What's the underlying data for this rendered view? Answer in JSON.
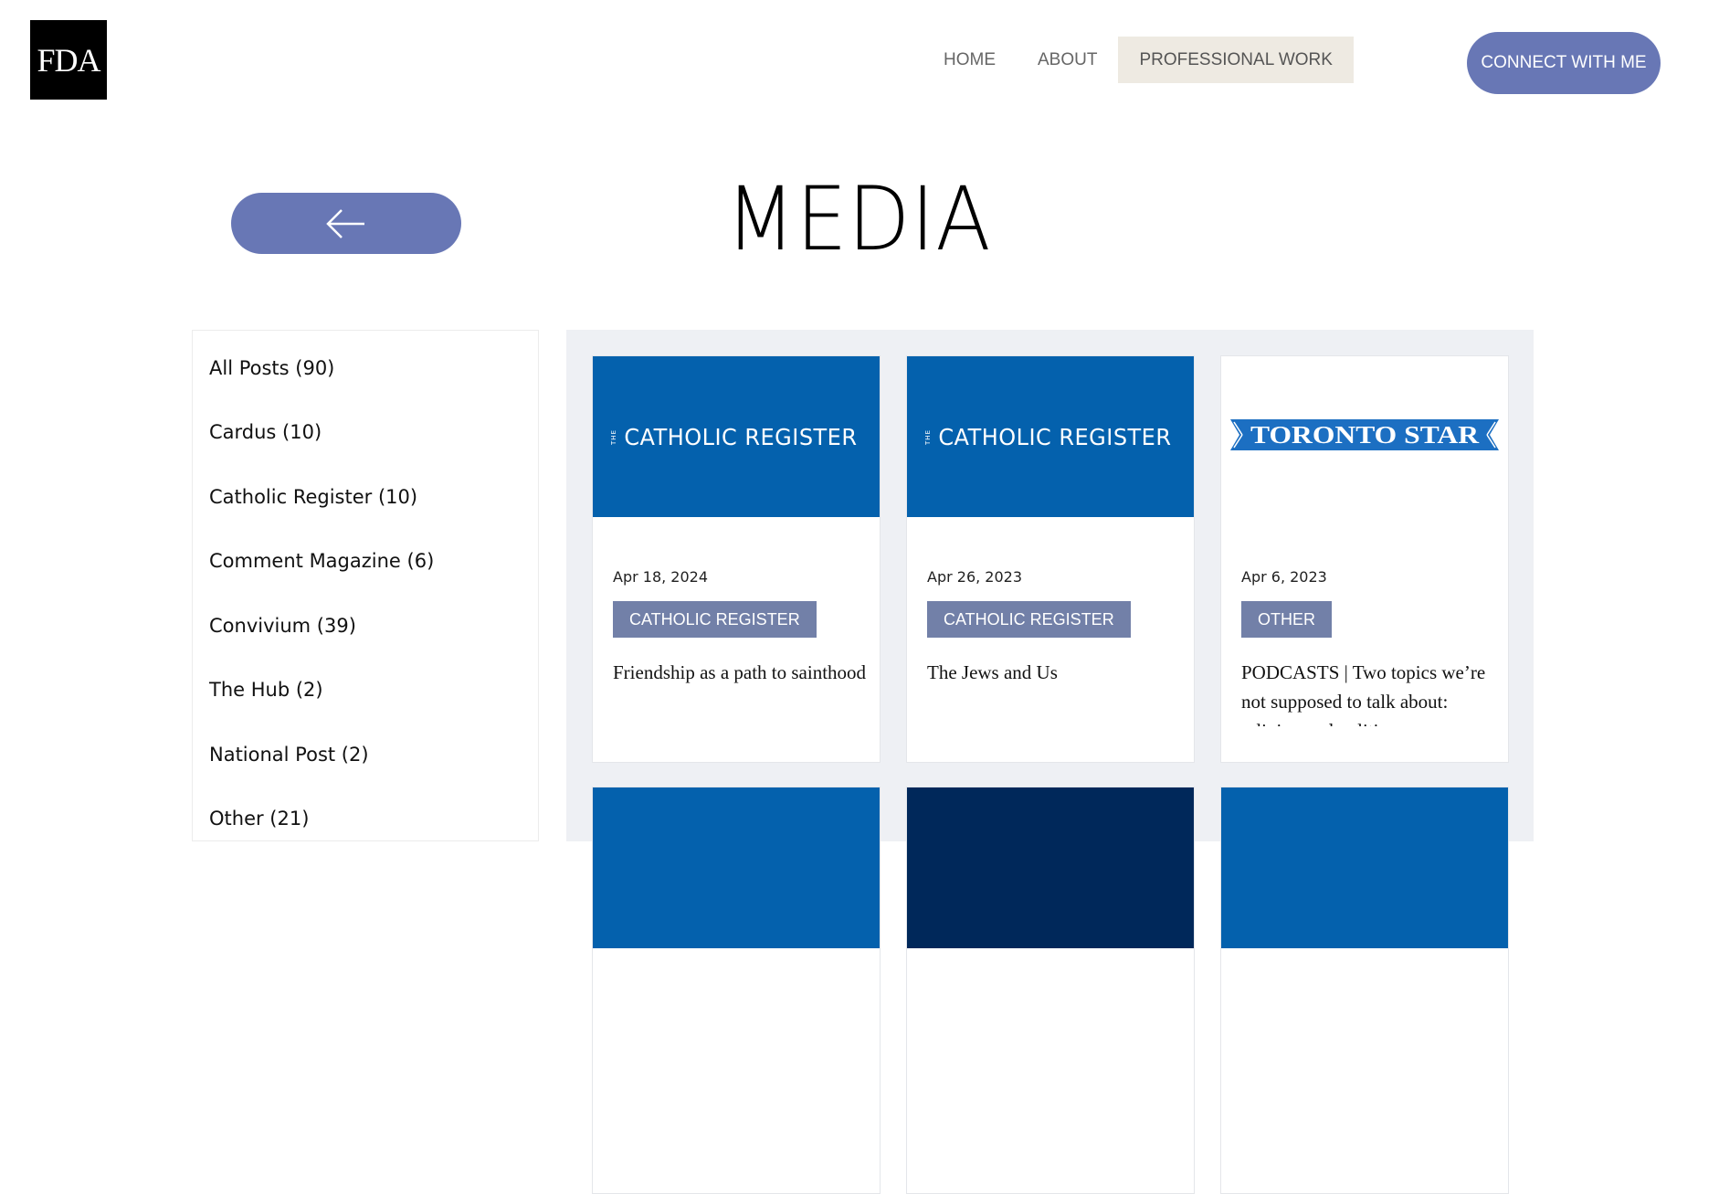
{
  "header": {
    "logo_text": "FDA",
    "nav": [
      {
        "label": "HOME"
      },
      {
        "label": "ABOUT"
      },
      {
        "label": "PROFESSIONAL WORK"
      }
    ],
    "connect_label": "CONNECT WITH ME"
  },
  "page": {
    "title": "MEDIA",
    "back_icon": "arrow-left-icon"
  },
  "categories": [
    {
      "label": "All Posts (90)"
    },
    {
      "label": "Cardus (10)"
    },
    {
      "label": "Catholic Register (10)"
    },
    {
      "label": "Comment Magazine (6)"
    },
    {
      "label": "Convivium (39)"
    },
    {
      "label": "The Hub (2)"
    },
    {
      "label": "National Post (2)"
    },
    {
      "label": "Other (21)"
    }
  ],
  "posts": [
    {
      "logo_small": "THE",
      "logo": "CATHOLIC REGISTER",
      "date": "Apr 18, 2024",
      "tag": "CATHOLIC REGISTER",
      "title": "Friendship as a path to sainthood"
    },
    {
      "logo_small": "THE",
      "logo": "CATHOLIC REGISTER",
      "date": "Apr 26, 2023",
      "tag": "CATHOLIC REGISTER",
      "title": "The Jews and Us"
    },
    {
      "logo": "TORONTO STAR",
      "date": "Apr 6, 2023",
      "tag": "OTHER",
      "title": "PODCASTS | Two topics we’re not supposed to talk about: religion and politics"
    }
  ],
  "colors": {
    "accent": "#6877b5",
    "nav_active_bg": "#eeeae2",
    "tag_bg": "#7280a8",
    "catholic_register_blue": "#0461ad",
    "toronto_star_blue": "#1c6fc2",
    "navy": "#00285a",
    "grid_bg": "#eef0f4"
  }
}
